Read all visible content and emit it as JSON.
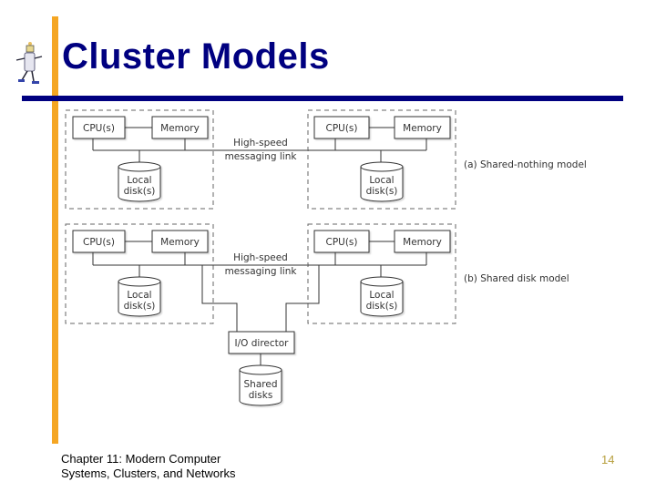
{
  "slide": {
    "title": "Cluster Models",
    "footer_line1": "Chapter 11: Modern Computer",
    "footer_line2": "Systems, Clusters, and Networks",
    "page_number": "14"
  },
  "colors": {
    "title": "#000080",
    "rule": "#000080",
    "accent_bar": "#f5a623",
    "page_number": "#b8a040"
  },
  "diagram": {
    "shared_nothing": {
      "caption": "(a) Shared-nothing model",
      "link_label_line1": "High-speed",
      "link_label_line2": "messaging link",
      "nodes": [
        {
          "cpu": "CPU(s)",
          "memory": "Memory",
          "disk_line1": "Local",
          "disk_line2": "disk(s)"
        },
        {
          "cpu": "CPU(s)",
          "memory": "Memory",
          "disk_line1": "Local",
          "disk_line2": "disk(s)"
        }
      ]
    },
    "shared_disk": {
      "caption": "(b) Shared disk model",
      "link_label_line1": "High-speed",
      "link_label_line2": "messaging link",
      "nodes": [
        {
          "cpu": "CPU(s)",
          "memory": "Memory",
          "disk_line1": "Local",
          "disk_line2": "disk(s)"
        },
        {
          "cpu": "CPU(s)",
          "memory": "Memory",
          "disk_line1": "Local",
          "disk_line2": "disk(s)"
        }
      ],
      "io_director": "I/O director",
      "shared_disks_line1": "Shared",
      "shared_disks_line2": "disks"
    }
  }
}
